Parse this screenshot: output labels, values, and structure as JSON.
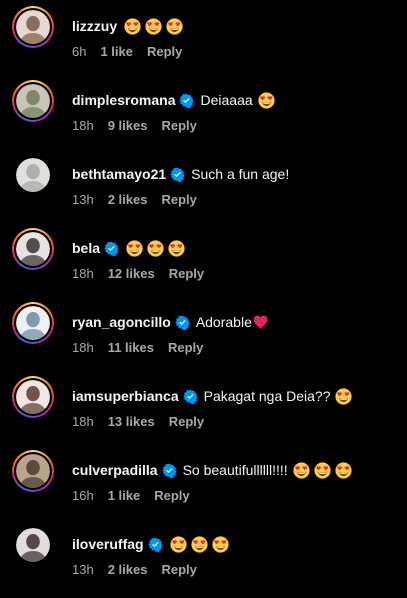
{
  "comments": [
    {
      "username": "lizzzuy",
      "verified": false,
      "text": "",
      "emoji_count": 3,
      "heart": false,
      "time": "6h",
      "likes": "1 like",
      "reply": "Reply",
      "story_ring": true,
      "avatar_colors": [
        "#e9d8cf",
        "#7a5b4a"
      ]
    },
    {
      "username": "dimplesromana",
      "verified": true,
      "text": "Deiaaaa",
      "emoji_count": 1,
      "heart": false,
      "time": "18h",
      "likes": "9 likes",
      "reply": "Reply",
      "story_ring": true,
      "avatar_colors": [
        "#c9c5b8",
        "#6e7d5a"
      ]
    },
    {
      "username": "bethtamayo21",
      "verified": true,
      "text": "Such a fun age!",
      "emoji_count": 0,
      "heart": false,
      "time": "13h",
      "likes": "2 likes",
      "reply": "Reply",
      "story_ring": false,
      "avatar_colors": [
        "#dfe0de",
        "#a9a6a0"
      ]
    },
    {
      "username": "bela",
      "verified": true,
      "text": "",
      "emoji_count": 3,
      "heart": false,
      "time": "18h",
      "likes": "12 likes",
      "reply": "Reply",
      "story_ring": true,
      "avatar_colors": [
        "#e7e2de",
        "#3a3030"
      ]
    },
    {
      "username": "ryan_agoncillo",
      "verified": true,
      "text": "Adorable",
      "emoji_count": 0,
      "heart": true,
      "time": "18h",
      "likes": "11 likes",
      "reply": "Reply",
      "story_ring": true,
      "avatar_colors": [
        "#eef2f4",
        "#6c8aa0"
      ]
    },
    {
      "username": "iamsuperbianca",
      "verified": true,
      "text": "Pakagat nga Deia??",
      "emoji_count": 1,
      "heart": false,
      "time": "18h",
      "likes": "13 likes",
      "reply": "Reply",
      "story_ring": true,
      "avatar_colors": [
        "#f1e6e0",
        "#5a3a2e"
      ]
    },
    {
      "username": "culverpadilla",
      "verified": true,
      "text": "So beautifullllll!!!!",
      "emoji_count": 3,
      "heart": false,
      "time": "16h",
      "likes": "1 like",
      "reply": "Reply",
      "story_ring": true,
      "avatar_colors": [
        "#b9a48c",
        "#4a3a2c"
      ]
    },
    {
      "username": "iloveruffag",
      "verified": true,
      "text": "",
      "emoji_count": 3,
      "heart": false,
      "time": "13h",
      "likes": "2 likes",
      "reply": "Reply",
      "story_ring": false,
      "avatar_colors": [
        "#e2ddd8",
        "#3b2e2a"
      ]
    }
  ],
  "icons": {
    "verified": "verified-badge-icon",
    "emoji": "heart-eyes-emoji",
    "heart": "red-heart-icon"
  },
  "colors": {
    "background": "#000000",
    "text": "#f5f5f5",
    "meta": "#a8a8a8",
    "verified": "#0095f6",
    "heart": "#e0245e"
  }
}
